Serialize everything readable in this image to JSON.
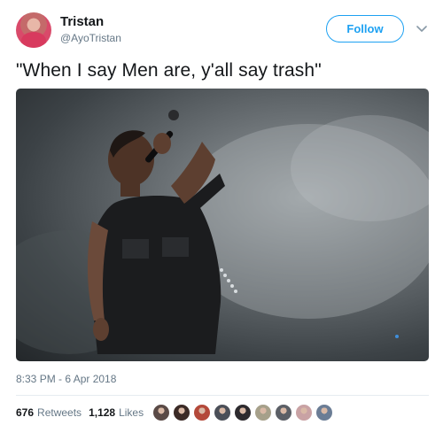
{
  "user": {
    "name": "Tristan",
    "handle": "@AyoTristan",
    "avatar_icon": "user-avatar"
  },
  "follow_button": {
    "label": "Follow"
  },
  "more_menu": {
    "icon": "chevron-down-icon"
  },
  "tweet": {
    "text": "\"When I say Men are, y'all say trash\"",
    "media": {
      "kind": "photo",
      "icon": "concert-photo"
    },
    "timestamp": "8:33 PM - 6 Apr 2018"
  },
  "stats": {
    "retweets_count": "676",
    "retweets_label": "Retweets",
    "likes_count": "1,128",
    "likes_label": "Likes"
  },
  "likers": {
    "count_shown": 9,
    "colors": [
      "#5a4a46",
      "#3b2a26",
      "#b4493a",
      "#4b4f58",
      "#2d2a2e",
      "#a6a08a",
      "#5b5f66",
      "#c9a2a4",
      "#6b7d95"
    ]
  },
  "colors": {
    "accent": "#1da1f2",
    "text": "#14171a",
    "muted": "#657786",
    "divider": "#e6ecf0"
  }
}
